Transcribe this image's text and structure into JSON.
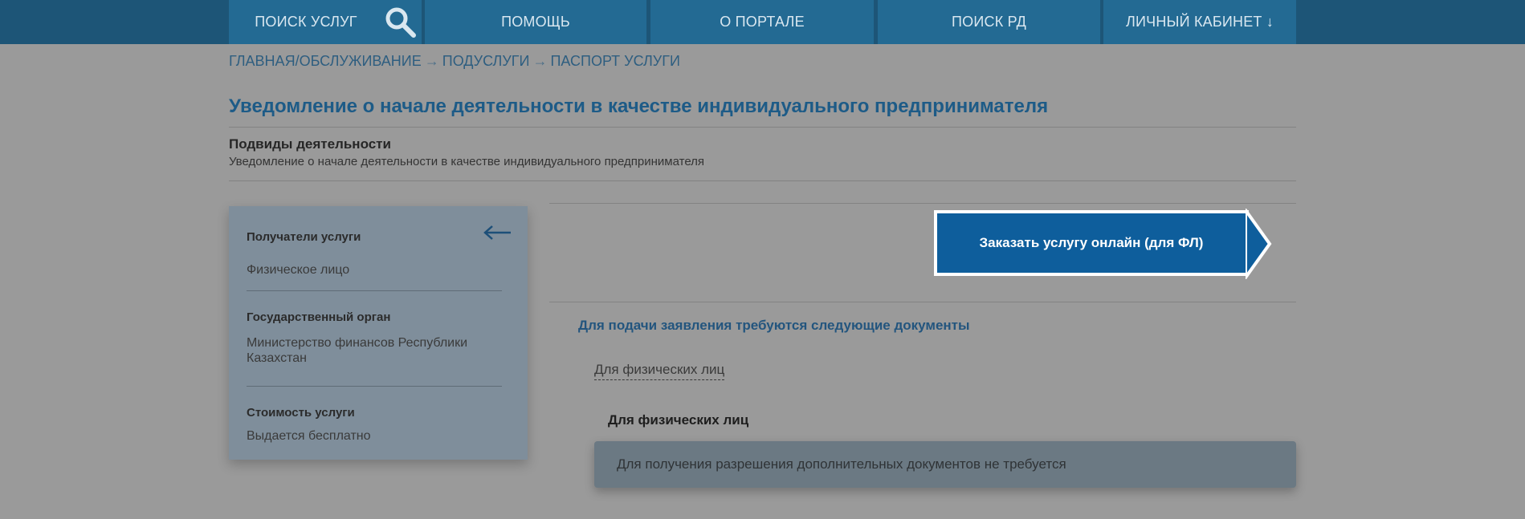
{
  "nav": {
    "items": [
      {
        "label": "ПОИСК УСЛУГ"
      },
      {
        "label": "ПОМОЩЬ"
      },
      {
        "label": "О ПОРТАЛЕ"
      },
      {
        "label": "ПОИСК РД"
      },
      {
        "label": "ЛИЧНЫЙ КАБИНЕТ ↓"
      }
    ],
    "search_icon": "search-icon"
  },
  "breadcrumb": {
    "items": [
      "ГЛАВНАЯ/ОБСЛУЖИВАНИЕ",
      "ПОДУСЛУГИ",
      "ПАСПОРТ УСЛУГИ"
    ],
    "separator": "→"
  },
  "page": {
    "title": "Уведомление о начале деятельности в качестве индивидуального предпринимателя",
    "subtypes_label": "Подвиды деятельности",
    "subtypes_value": "Уведомление о начале деятельности в качестве индивидуального предпринимателя"
  },
  "sidebar": {
    "back_icon": "arrow-left-icon",
    "recipients_label": "Получатели услуги",
    "recipients_value": "Физическое лицо",
    "agency_label": "Государственный орган",
    "agency_value": "Министерство финансов Республики Казахстан",
    "cost_label": "Стоимость услуги",
    "cost_value": "Выдается бесплатно"
  },
  "order_button": {
    "label": "Заказать услугу онлайн (для ФЛ)"
  },
  "documents": {
    "heading": "Для подачи заявления требуются следующие документы",
    "tab_label": "Для физических лиц",
    "section_title": "Для физических лиц",
    "notice": "Для получения разрешения дополнительных документов не требуется"
  },
  "colors": {
    "nav_bg": "#236a93",
    "topbar_bg": "#1d5577",
    "accent": "#0e5e9c",
    "title": "#1d5b87",
    "sidebar_bg": "#7f8e9b",
    "page_bg": "#9a9a9a"
  }
}
